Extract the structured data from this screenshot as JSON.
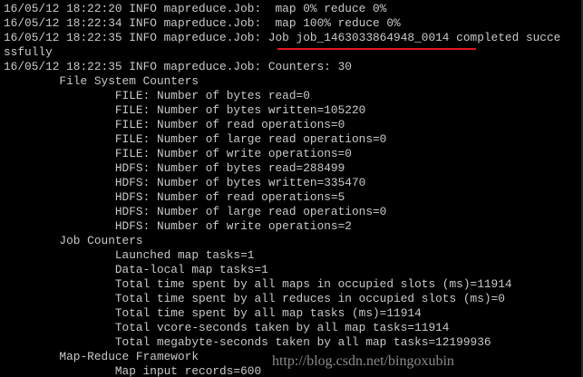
{
  "terminal": {
    "lines": [
      "16/05/12 18:22:20 INFO mapreduce.Job:  map 0% reduce 0%",
      "16/05/12 18:22:34 INFO mapreduce.Job:  map 100% reduce 0%",
      "16/05/12 18:22:35 INFO mapreduce.Job: Job job_1463033864948_0014 completed succe",
      "ssfully",
      "16/05/12 18:22:35 INFO mapreduce.Job: Counters: 30",
      "        File System Counters",
      "                FILE: Number of bytes read=0",
      "                FILE: Number of bytes written=105220",
      "                FILE: Number of read operations=0",
      "                FILE: Number of large read operations=0",
      "                FILE: Number of write operations=0",
      "                HDFS: Number of bytes read=288499",
      "                HDFS: Number of bytes written=335470",
      "                HDFS: Number of read operations=5",
      "                HDFS: Number of large read operations=0",
      "                HDFS: Number of write operations=2",
      "        Job Counters",
      "                Launched map tasks=1",
      "                Data-local map tasks=1",
      "                Total time spent by all maps in occupied slots (ms)=11914",
      "                Total time spent by all reduces in occupied slots (ms)=0",
      "                Total time spent by all map tasks (ms)=11914",
      "                Total vcore-seconds taken by all map tasks=11914",
      "                Total megabyte-seconds taken by all map tasks=12199936",
      "        Map-Reduce Framework",
      "                Map input records=600"
    ]
  },
  "watermark": {
    "text": "http://blog.csdn.net/bingoxubin"
  },
  "colors": {
    "background": "#000000",
    "text": "#c9c9c9",
    "highlight_underline": "#e0181e",
    "watermark": "#8a8a8a"
  }
}
